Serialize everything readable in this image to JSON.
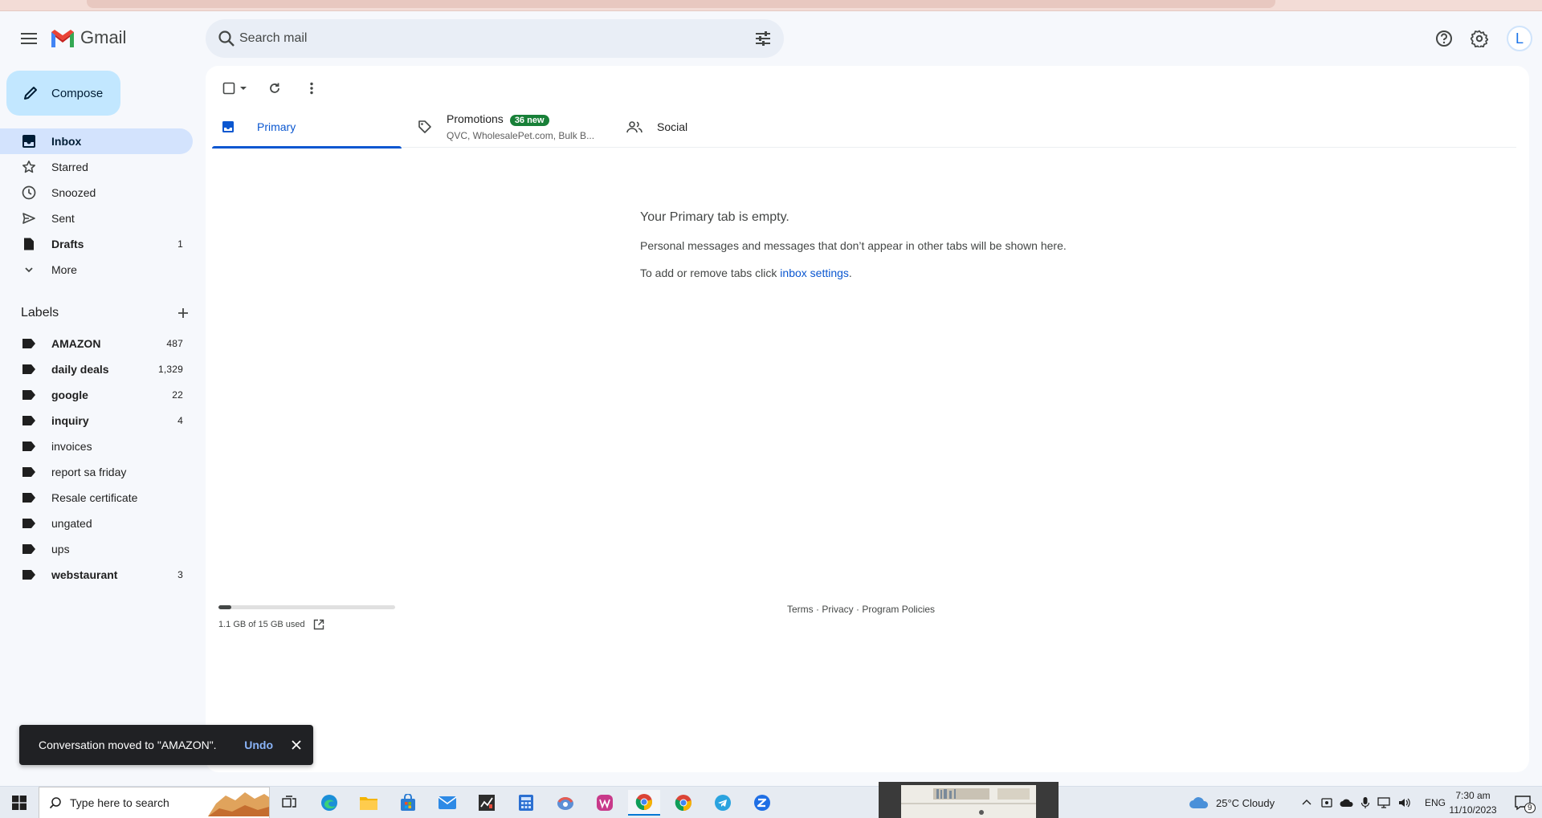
{
  "app": {
    "name": "Gmail"
  },
  "search": {
    "placeholder": "Search mail"
  },
  "compose": {
    "label": "Compose"
  },
  "nav": [
    {
      "label": "Inbox",
      "count": "",
      "active": true
    },
    {
      "label": "Starred",
      "count": ""
    },
    {
      "label": "Snoozed",
      "count": ""
    },
    {
      "label": "Sent",
      "count": ""
    },
    {
      "label": "Drafts",
      "count": "1"
    },
    {
      "label": "More",
      "count": ""
    }
  ],
  "labels": {
    "title": "Labels",
    "items": [
      {
        "label": "AMAZON",
        "count": "487"
      },
      {
        "label": "daily deals",
        "count": "1,329"
      },
      {
        "label": "google",
        "count": "22"
      },
      {
        "label": "inquiry",
        "count": "4"
      },
      {
        "label": "invoices",
        "count": ""
      },
      {
        "label": "report sa friday",
        "count": ""
      },
      {
        "label": "Resale certificate",
        "count": ""
      },
      {
        "label": "ungated",
        "count": ""
      },
      {
        "label": "ups",
        "count": ""
      },
      {
        "label": "webstaurant",
        "count": "3"
      }
    ]
  },
  "tabs": {
    "primary": "Primary",
    "promotions": "Promotions",
    "promotions_badge": "36 new",
    "promotions_sub": "QVC, WholesalePet.com, Bulk B...",
    "social": "Social"
  },
  "empty": {
    "title": "Your Primary tab is empty.",
    "line1": "Personal messages and messages that don’t appear in other tabs will be shown here.",
    "line2_prefix": "To add or remove tabs click ",
    "line2_link": "inbox settings",
    "line2_suffix": "."
  },
  "storage": {
    "text": "1.1 GB of 15 GB used",
    "fraction": 0.073
  },
  "footer": {
    "terms": "Terms",
    "privacy": "Privacy",
    "policies": "Program Policies",
    "sep": " · "
  },
  "toast": {
    "message": "Conversation moved to \"AMAZON\".",
    "undo": "Undo"
  },
  "avatar": {
    "initial": "L"
  },
  "taskbar": {
    "search_placeholder": "Type here to search",
    "weather": "25°C  Cloudy",
    "lang": "ENG",
    "time": "7:30 am",
    "date": "11/10/2023",
    "notifications": "9"
  },
  "colors": {
    "accent": "#0b57d0",
    "compose_bg": "#c2e7ff",
    "active_nav": "#d3e3fd",
    "badge": "#188038"
  }
}
